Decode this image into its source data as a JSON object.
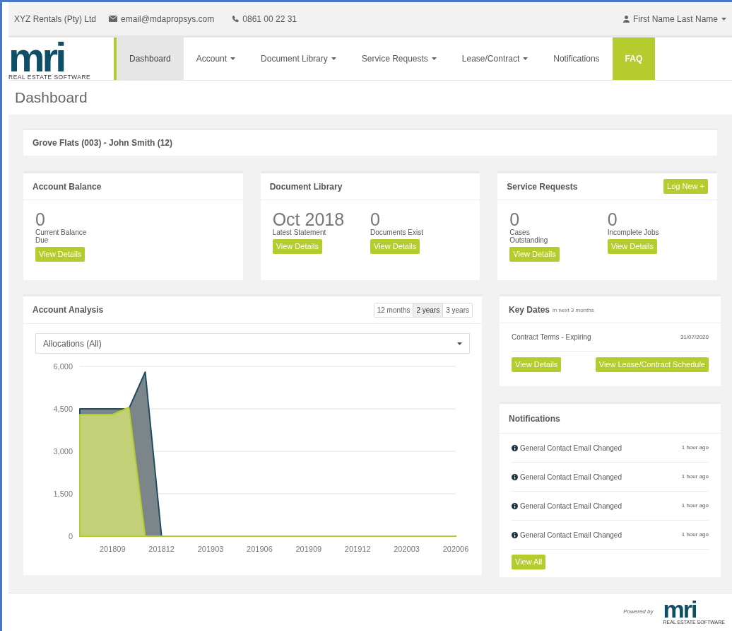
{
  "topbar": {
    "company": "XYZ Rentals (Pty) Ltd",
    "email": "email@mdapropsys.com",
    "phone": "0861 00 22 31",
    "user": "First Name Last Name"
  },
  "logo": {
    "mark": "mri",
    "tagline": "REAL ESTATE SOFTWARE"
  },
  "nav": [
    {
      "label": "Dashboard",
      "selected": true,
      "dropdown": false,
      "highlight": false
    },
    {
      "label": "Account",
      "selected": false,
      "dropdown": true,
      "highlight": false
    },
    {
      "label": "Document Library",
      "selected": false,
      "dropdown": true,
      "highlight": false
    },
    {
      "label": "Service Requests",
      "selected": false,
      "dropdown": true,
      "highlight": false
    },
    {
      "label": "Lease/Contract",
      "selected": false,
      "dropdown": true,
      "highlight": false
    },
    {
      "label": "Notifications",
      "selected": false,
      "dropdown": false,
      "highlight": false
    },
    {
      "label": "FAQ",
      "selected": false,
      "dropdown": false,
      "highlight": true
    }
  ],
  "page_title": "Dashboard",
  "property": "Grove Flats (003) - John Smith (12)",
  "cards": [
    {
      "title": "Account Balance",
      "stats": [
        {
          "value": "0",
          "label": "Current Balance Due",
          "button": "View Details"
        }
      ]
    },
    {
      "title": "Document Library",
      "stats": [
        {
          "value": "Oct 2018",
          "label": "Latest Statement",
          "button": "View Details"
        },
        {
          "value": "0",
          "label": "Documents Exist",
          "button": "View Details"
        }
      ]
    },
    {
      "title": "Service Requests",
      "action": "Log New +",
      "stats": [
        {
          "value": "0",
          "label": "Cases Outstanding",
          "button": "View Details"
        },
        {
          "value": "0",
          "label": "Incomplete Jobs",
          "button": "View Details"
        }
      ]
    }
  ],
  "analysis": {
    "title": "Account Analysis",
    "ranges": [
      {
        "label": "12 months",
        "selected": false
      },
      {
        "label": "2 years",
        "selected": true
      },
      {
        "label": "3 years",
        "selected": false
      }
    ],
    "select": "Allocations (All)",
    "chart_data": {
      "type": "area",
      "grid": true,
      "categories": [
        null,
        null,
        "201809",
        null,
        null,
        "201812",
        null,
        null,
        "201903",
        null,
        null,
        "201906",
        null,
        null,
        "201909",
        null,
        null,
        "201912",
        null,
        null,
        "202003",
        null,
        null,
        "202006"
      ],
      "series": [
        {
          "color": "#7c8589",
          "values": [
            4500,
            4500,
            4500,
            4500,
            5800,
            0,
            0,
            0,
            0,
            0,
            0,
            0,
            0,
            0,
            0,
            0,
            0,
            0,
            0,
            0,
            0,
            0,
            0,
            0
          ]
        },
        {
          "color": "#c2d077",
          "values": [
            4300,
            4300,
            4300,
            4550,
            0,
            0,
            0,
            0,
            0,
            0,
            0,
            0,
            0,
            0,
            0,
            0,
            0,
            0,
            0,
            0,
            0,
            0,
            0,
            0
          ]
        }
      ],
      "ylim": [
        0,
        6000
      ],
      "yticks": [
        0,
        {
          "value": 1500,
          "label": "1,500"
        },
        {
          "value": 3000,
          "label": "3,000"
        },
        {
          "value": 4500,
          "label": "4,500"
        },
        {
          "value": 6000,
          "label": "6,000"
        }
      ]
    }
  },
  "key_dates": {
    "title": "Key Dates",
    "subtitle": "in next 3 months",
    "items": [
      {
        "label": "Contract Terms - Expiring",
        "date": "31/07/2020"
      }
    ],
    "buttons": [
      "View Details",
      "View Lease/Contract Schedule"
    ]
  },
  "notifications": {
    "title": "Notifications",
    "items": [
      {
        "text": "General Contact Email Changed",
        "time": "1 hour ago"
      },
      {
        "text": "General Contact Email Changed",
        "time": "1 hour ago"
      },
      {
        "text": "General Contact Email Changed",
        "time": "1 hour ago"
      },
      {
        "text": "General Contact Email Changed",
        "time": "1 hour ago"
      }
    ],
    "button": "View All"
  },
  "footer": {
    "powered_by": "Powered by",
    "logo_mark": "mri",
    "logo_tagline": "REAL ESTATE SOFTWARE"
  }
}
